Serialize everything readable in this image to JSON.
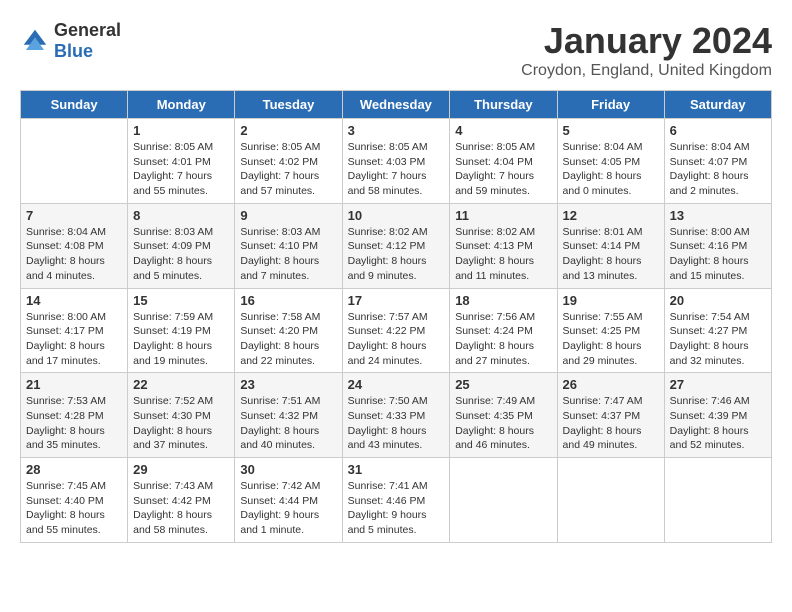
{
  "logo": {
    "general": "General",
    "blue": "Blue"
  },
  "title": "January 2024",
  "location": "Croydon, England, United Kingdom",
  "days_header": [
    "Sunday",
    "Monday",
    "Tuesday",
    "Wednesday",
    "Thursday",
    "Friday",
    "Saturday"
  ],
  "weeks": [
    [
      {
        "day": "",
        "sunrise": "",
        "sunset": "",
        "daylight": ""
      },
      {
        "day": "1",
        "sunrise": "Sunrise: 8:05 AM",
        "sunset": "Sunset: 4:01 PM",
        "daylight": "Daylight: 7 hours and 55 minutes."
      },
      {
        "day": "2",
        "sunrise": "Sunrise: 8:05 AM",
        "sunset": "Sunset: 4:02 PM",
        "daylight": "Daylight: 7 hours and 57 minutes."
      },
      {
        "day": "3",
        "sunrise": "Sunrise: 8:05 AM",
        "sunset": "Sunset: 4:03 PM",
        "daylight": "Daylight: 7 hours and 58 minutes."
      },
      {
        "day": "4",
        "sunrise": "Sunrise: 8:05 AM",
        "sunset": "Sunset: 4:04 PM",
        "daylight": "Daylight: 7 hours and 59 minutes."
      },
      {
        "day": "5",
        "sunrise": "Sunrise: 8:04 AM",
        "sunset": "Sunset: 4:05 PM",
        "daylight": "Daylight: 8 hours and 0 minutes."
      },
      {
        "day": "6",
        "sunrise": "Sunrise: 8:04 AM",
        "sunset": "Sunset: 4:07 PM",
        "daylight": "Daylight: 8 hours and 2 minutes."
      }
    ],
    [
      {
        "day": "7",
        "sunrise": "Sunrise: 8:04 AM",
        "sunset": "Sunset: 4:08 PM",
        "daylight": "Daylight: 8 hours and 4 minutes."
      },
      {
        "day": "8",
        "sunrise": "Sunrise: 8:03 AM",
        "sunset": "Sunset: 4:09 PM",
        "daylight": "Daylight: 8 hours and 5 minutes."
      },
      {
        "day": "9",
        "sunrise": "Sunrise: 8:03 AM",
        "sunset": "Sunset: 4:10 PM",
        "daylight": "Daylight: 8 hours and 7 minutes."
      },
      {
        "day": "10",
        "sunrise": "Sunrise: 8:02 AM",
        "sunset": "Sunset: 4:12 PM",
        "daylight": "Daylight: 8 hours and 9 minutes."
      },
      {
        "day": "11",
        "sunrise": "Sunrise: 8:02 AM",
        "sunset": "Sunset: 4:13 PM",
        "daylight": "Daylight: 8 hours and 11 minutes."
      },
      {
        "day": "12",
        "sunrise": "Sunrise: 8:01 AM",
        "sunset": "Sunset: 4:14 PM",
        "daylight": "Daylight: 8 hours and 13 minutes."
      },
      {
        "day": "13",
        "sunrise": "Sunrise: 8:00 AM",
        "sunset": "Sunset: 4:16 PM",
        "daylight": "Daylight: 8 hours and 15 minutes."
      }
    ],
    [
      {
        "day": "14",
        "sunrise": "Sunrise: 8:00 AM",
        "sunset": "Sunset: 4:17 PM",
        "daylight": "Daylight: 8 hours and 17 minutes."
      },
      {
        "day": "15",
        "sunrise": "Sunrise: 7:59 AM",
        "sunset": "Sunset: 4:19 PM",
        "daylight": "Daylight: 8 hours and 19 minutes."
      },
      {
        "day": "16",
        "sunrise": "Sunrise: 7:58 AM",
        "sunset": "Sunset: 4:20 PM",
        "daylight": "Daylight: 8 hours and 22 minutes."
      },
      {
        "day": "17",
        "sunrise": "Sunrise: 7:57 AM",
        "sunset": "Sunset: 4:22 PM",
        "daylight": "Daylight: 8 hours and 24 minutes."
      },
      {
        "day": "18",
        "sunrise": "Sunrise: 7:56 AM",
        "sunset": "Sunset: 4:24 PM",
        "daylight": "Daylight: 8 hours and 27 minutes."
      },
      {
        "day": "19",
        "sunrise": "Sunrise: 7:55 AM",
        "sunset": "Sunset: 4:25 PM",
        "daylight": "Daylight: 8 hours and 29 minutes."
      },
      {
        "day": "20",
        "sunrise": "Sunrise: 7:54 AM",
        "sunset": "Sunset: 4:27 PM",
        "daylight": "Daylight: 8 hours and 32 minutes."
      }
    ],
    [
      {
        "day": "21",
        "sunrise": "Sunrise: 7:53 AM",
        "sunset": "Sunset: 4:28 PM",
        "daylight": "Daylight: 8 hours and 35 minutes."
      },
      {
        "day": "22",
        "sunrise": "Sunrise: 7:52 AM",
        "sunset": "Sunset: 4:30 PM",
        "daylight": "Daylight: 8 hours and 37 minutes."
      },
      {
        "day": "23",
        "sunrise": "Sunrise: 7:51 AM",
        "sunset": "Sunset: 4:32 PM",
        "daylight": "Daylight: 8 hours and 40 minutes."
      },
      {
        "day": "24",
        "sunrise": "Sunrise: 7:50 AM",
        "sunset": "Sunset: 4:33 PM",
        "daylight": "Daylight: 8 hours and 43 minutes."
      },
      {
        "day": "25",
        "sunrise": "Sunrise: 7:49 AM",
        "sunset": "Sunset: 4:35 PM",
        "daylight": "Daylight: 8 hours and 46 minutes."
      },
      {
        "day": "26",
        "sunrise": "Sunrise: 7:47 AM",
        "sunset": "Sunset: 4:37 PM",
        "daylight": "Daylight: 8 hours and 49 minutes."
      },
      {
        "day": "27",
        "sunrise": "Sunrise: 7:46 AM",
        "sunset": "Sunset: 4:39 PM",
        "daylight": "Daylight: 8 hours and 52 minutes."
      }
    ],
    [
      {
        "day": "28",
        "sunrise": "Sunrise: 7:45 AM",
        "sunset": "Sunset: 4:40 PM",
        "daylight": "Daylight: 8 hours and 55 minutes."
      },
      {
        "day": "29",
        "sunrise": "Sunrise: 7:43 AM",
        "sunset": "Sunset: 4:42 PM",
        "daylight": "Daylight: 8 hours and 58 minutes."
      },
      {
        "day": "30",
        "sunrise": "Sunrise: 7:42 AM",
        "sunset": "Sunset: 4:44 PM",
        "daylight": "Daylight: 9 hours and 1 minute."
      },
      {
        "day": "31",
        "sunrise": "Sunrise: 7:41 AM",
        "sunset": "Sunset: 4:46 PM",
        "daylight": "Daylight: 9 hours and 5 minutes."
      },
      {
        "day": "",
        "sunrise": "",
        "sunset": "",
        "daylight": ""
      },
      {
        "day": "",
        "sunrise": "",
        "sunset": "",
        "daylight": ""
      },
      {
        "day": "",
        "sunrise": "",
        "sunset": "",
        "daylight": ""
      }
    ]
  ]
}
